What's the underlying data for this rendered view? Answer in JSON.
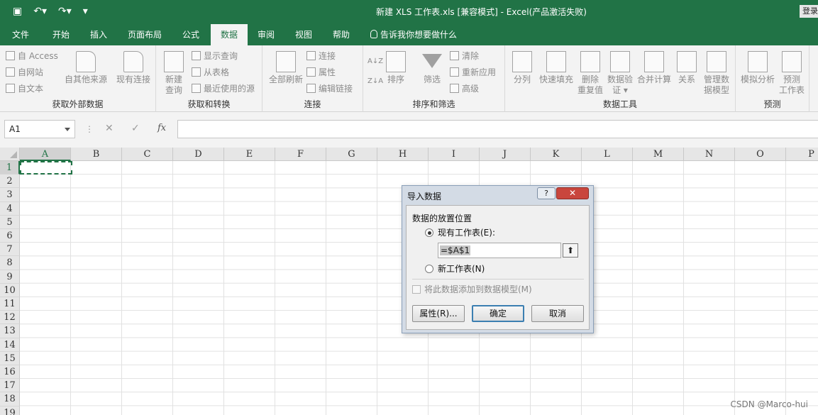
{
  "titlebar": {
    "title": "新建 XLS 工作表.xls  [兼容模式]  -  Excel(产品激活失败)",
    "login": "登录",
    "qat": [
      "save-icon",
      "undo-icon",
      "redo-icon",
      "customize-icon"
    ]
  },
  "tabs": [
    {
      "label": "文件"
    },
    {
      "label": "开始"
    },
    {
      "label": "插入"
    },
    {
      "label": "页面布局"
    },
    {
      "label": "公式"
    },
    {
      "label": "数据"
    },
    {
      "label": "审阅"
    },
    {
      "label": "视图"
    },
    {
      "label": "帮助"
    }
  ],
  "active_tab": "数据",
  "tellme": "告诉我你想要做什么",
  "ribbon": {
    "get_external": {
      "label": "获取外部数据",
      "items": [
        "自 Access",
        "自网站",
        "自文本"
      ],
      "other_sources": "自其他来源",
      "existing_connections": "现有连接"
    },
    "get_transform": {
      "label": "获取和转换",
      "new_query_line1": "新建",
      "new_query_line2": "查询",
      "items": [
        "显示查询",
        "从表格",
        "最近使用的源"
      ]
    },
    "connections": {
      "label": "连接",
      "refresh_all": "全部刷新",
      "items": [
        "连接",
        "属性",
        "编辑链接"
      ]
    },
    "sort_filter": {
      "label": "排序和筛选",
      "sort_az": "A↓Z",
      "sort_za": "Z↓A",
      "sort": "排序",
      "filter": "筛选",
      "items": [
        "清除",
        "重新应用",
        "高级"
      ]
    },
    "data_tools": {
      "label": "数据工具",
      "buttons": [
        {
          "l1": "分列",
          "l2": ""
        },
        {
          "l1": "快速填充",
          "l2": ""
        },
        {
          "l1": "删除",
          "l2": "重复值"
        },
        {
          "l1": "数据验",
          "l2": "证 ▾"
        },
        {
          "l1": "合并计算",
          "l2": ""
        },
        {
          "l1": "关系",
          "l2": ""
        },
        {
          "l1": "管理数",
          "l2": "据模型"
        }
      ]
    },
    "forecast": {
      "label": "预测",
      "whatif": "模拟分析",
      "sheet_l1": "预测",
      "sheet_l2": "工作表"
    }
  },
  "formula_bar": {
    "name_box": "A1",
    "sep": "⋮",
    "cancel": "✕",
    "enter": "✓",
    "fx": "fx",
    "value": ""
  },
  "grid": {
    "columns": [
      "A",
      "B",
      "C",
      "D",
      "E",
      "F",
      "G",
      "H",
      "I",
      "J",
      "K",
      "L",
      "M",
      "N",
      "O",
      "P"
    ],
    "rows": [
      "1",
      "2",
      "3",
      "4",
      "5",
      "6",
      "7",
      "8",
      "9",
      "10",
      "11",
      "12",
      "13",
      "14",
      "15",
      "16",
      "17",
      "18",
      "19"
    ]
  },
  "dialog": {
    "title": "导入数据",
    "help": "?",
    "close": "✕",
    "section_label": "数据的放置位置",
    "existing_sheet": "现有工作表(E):",
    "existing_selected": true,
    "ref_value": "=$A$1",
    "ref_button": "⬆",
    "new_sheet": "新工作表(N)",
    "add_to_model": "将此数据添加到数据模型(M)",
    "properties": "属性(R)...",
    "ok": "确定",
    "cancel": "取消"
  },
  "watermark": "CSDN @Marco-hui"
}
